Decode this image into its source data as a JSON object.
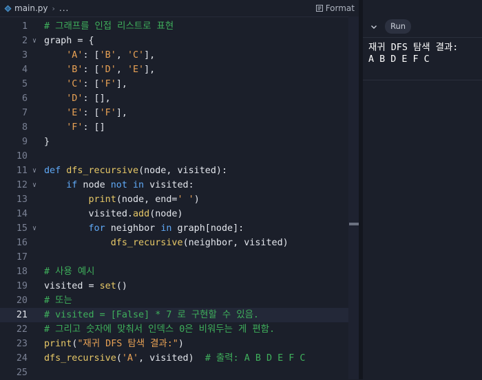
{
  "tab": {
    "filename": "main.py",
    "breadcrumb_more": "...",
    "format_label": "Format"
  },
  "output_panel": {
    "run_label": "Run",
    "lines": [
      "재귀 DFS 탐색 결과:",
      "A B D E F C"
    ]
  },
  "editor": {
    "active_line": 21,
    "lines": [
      {
        "n": 1,
        "fold": false,
        "indent": 0,
        "tokens": [
          {
            "t": "# 그래프를 인접 리스트로 표현",
            "c": "cm"
          }
        ]
      },
      {
        "n": 2,
        "fold": true,
        "indent": 0,
        "tokens": [
          {
            "t": "graph = {",
            "c": ""
          }
        ]
      },
      {
        "n": 3,
        "fold": false,
        "indent": 4,
        "tokens": [
          {
            "t": "'A'",
            "c": "str"
          },
          {
            "t": ": [",
            "c": ""
          },
          {
            "t": "'B'",
            "c": "str"
          },
          {
            "t": ", ",
            "c": ""
          },
          {
            "t": "'C'",
            "c": "str"
          },
          {
            "t": "],",
            "c": ""
          }
        ]
      },
      {
        "n": 4,
        "fold": false,
        "indent": 4,
        "tokens": [
          {
            "t": "'B'",
            "c": "str"
          },
          {
            "t": ": [",
            "c": ""
          },
          {
            "t": "'D'",
            "c": "str"
          },
          {
            "t": ", ",
            "c": ""
          },
          {
            "t": "'E'",
            "c": "str"
          },
          {
            "t": "],",
            "c": ""
          }
        ]
      },
      {
        "n": 5,
        "fold": false,
        "indent": 4,
        "tokens": [
          {
            "t": "'C'",
            "c": "str"
          },
          {
            "t": ": [",
            "c": ""
          },
          {
            "t": "'F'",
            "c": "str"
          },
          {
            "t": "],",
            "c": ""
          }
        ]
      },
      {
        "n": 6,
        "fold": false,
        "indent": 4,
        "tokens": [
          {
            "t": "'D'",
            "c": "str"
          },
          {
            "t": ": [],",
            "c": ""
          }
        ]
      },
      {
        "n": 7,
        "fold": false,
        "indent": 4,
        "tokens": [
          {
            "t": "'E'",
            "c": "str"
          },
          {
            "t": ": [",
            "c": ""
          },
          {
            "t": "'F'",
            "c": "str"
          },
          {
            "t": "],",
            "c": ""
          }
        ]
      },
      {
        "n": 8,
        "fold": false,
        "indent": 4,
        "tokens": [
          {
            "t": "'F'",
            "c": "str"
          },
          {
            "t": ": []",
            "c": ""
          }
        ]
      },
      {
        "n": 9,
        "fold": false,
        "indent": 0,
        "tokens": [
          {
            "t": "}",
            "c": ""
          }
        ]
      },
      {
        "n": 10,
        "fold": false,
        "indent": 0,
        "tokens": []
      },
      {
        "n": 11,
        "fold": true,
        "indent": 0,
        "tokens": [
          {
            "t": "def",
            "c": "kw"
          },
          {
            "t": " ",
            "c": ""
          },
          {
            "t": "dfs_recursive",
            "c": "fn"
          },
          {
            "t": "(node, visited):",
            "c": ""
          }
        ]
      },
      {
        "n": 12,
        "fold": true,
        "indent": 4,
        "tokens": [
          {
            "t": "if",
            "c": "kw"
          },
          {
            "t": " node ",
            "c": ""
          },
          {
            "t": "not in",
            "c": "kw"
          },
          {
            "t": " visited:",
            "c": ""
          }
        ]
      },
      {
        "n": 13,
        "fold": false,
        "indent": 8,
        "tokens": [
          {
            "t": "print",
            "c": "fn"
          },
          {
            "t": "(node, end=",
            "c": ""
          },
          {
            "t": "' '",
            "c": "str"
          },
          {
            "t": ")",
            "c": ""
          }
        ]
      },
      {
        "n": 14,
        "fold": false,
        "indent": 8,
        "tokens": [
          {
            "t": "visited.",
            "c": ""
          },
          {
            "t": "add",
            "c": "fn"
          },
          {
            "t": "(node)",
            "c": ""
          }
        ]
      },
      {
        "n": 15,
        "fold": true,
        "indent": 8,
        "tokens": [
          {
            "t": "for",
            "c": "kw"
          },
          {
            "t": " neighbor ",
            "c": ""
          },
          {
            "t": "in",
            "c": "kw"
          },
          {
            "t": " graph[node]:",
            "c": ""
          }
        ]
      },
      {
        "n": 16,
        "fold": false,
        "indent": 12,
        "tokens": [
          {
            "t": "dfs_recursive",
            "c": "fn"
          },
          {
            "t": "(neighbor, visited)",
            "c": ""
          }
        ]
      },
      {
        "n": 17,
        "fold": false,
        "indent": 0,
        "tokens": []
      },
      {
        "n": 18,
        "fold": false,
        "indent": 0,
        "tokens": [
          {
            "t": "# 사용 예시",
            "c": "cm"
          }
        ]
      },
      {
        "n": 19,
        "fold": false,
        "indent": 0,
        "tokens": [
          {
            "t": "visited = ",
            "c": ""
          },
          {
            "t": "set",
            "c": "fn"
          },
          {
            "t": "()",
            "c": ""
          }
        ]
      },
      {
        "n": 20,
        "fold": false,
        "indent": 0,
        "tokens": [
          {
            "t": "# 또는",
            "c": "cm"
          }
        ]
      },
      {
        "n": 21,
        "fold": false,
        "indent": 0,
        "tokens": [
          {
            "t": "# visited = [False] * 7 로 구현할 수 있음.",
            "c": "cm"
          }
        ]
      },
      {
        "n": 22,
        "fold": false,
        "indent": 0,
        "tokens": [
          {
            "t": "# 그리고 숫자에 맞춰서 인덱스 0은 비워두는 게 편함.",
            "c": "cm"
          }
        ]
      },
      {
        "n": 23,
        "fold": false,
        "indent": 0,
        "tokens": [
          {
            "t": "print",
            "c": "fn"
          },
          {
            "t": "(",
            "c": ""
          },
          {
            "t": "\"재귀 DFS 탐색 결과:\"",
            "c": "str"
          },
          {
            "t": ")",
            "c": ""
          }
        ]
      },
      {
        "n": 24,
        "fold": false,
        "indent": 0,
        "tokens": [
          {
            "t": "dfs_recursive",
            "c": "fn"
          },
          {
            "t": "(",
            "c": ""
          },
          {
            "t": "'A'",
            "c": "str"
          },
          {
            "t": ", visited)  ",
            "c": ""
          },
          {
            "t": "# 출력: A B D E F C",
            "c": "cm"
          }
        ]
      },
      {
        "n": 25,
        "fold": false,
        "indent": 0,
        "tokens": []
      }
    ]
  },
  "colors": {
    "background": "#1b1f2a",
    "keyword": "#5fa8f5",
    "function": "#e7c867",
    "string": "#e9a255",
    "comment": "#3fb05c"
  }
}
